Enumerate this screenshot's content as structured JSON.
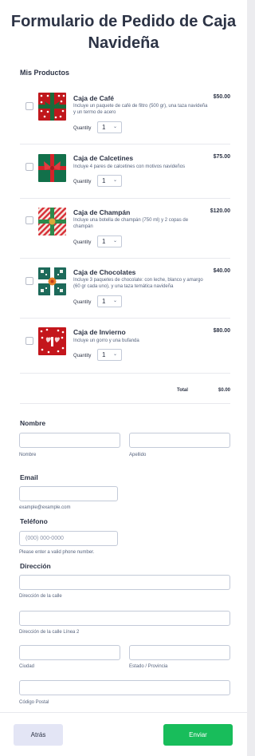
{
  "form": {
    "title_line1": "Formulario de Pedido de Caja",
    "title_line2": "Navideña",
    "products_label": "Mis Productos"
  },
  "products": [
    {
      "name": "Caja de Café",
      "price": "$50.00",
      "description": "Incluye un paquete de café de filtro (500 gr), una taza navideña y un termo de acero",
      "quantity_label": "Quantity",
      "quantity": "1",
      "image_icon": "gift-box-red-dots-icon",
      "image_color": "#c0171c"
    },
    {
      "name": "Caja de Calcetines",
      "price": "$75.00",
      "description": "Incluye 4 pares de calcetines con motivos navideños",
      "quantity_label": "Quantity",
      "quantity": "1",
      "image_icon": "gift-box-green-icon",
      "image_color": "#12704a"
    },
    {
      "name": "Caja de Champán",
      "price": "$120.00",
      "description": "Incluye una botella de champán (750 ml) y 2 copas de champán",
      "quantity_label": "Quantity",
      "quantity": "1",
      "image_icon": "gift-box-candy-stripe-icon",
      "image_color": "#d8333a"
    },
    {
      "name": "Caja de Chocolates",
      "price": "$40.00",
      "description": "Incluye 3 paquetes de chocolate: con leche, blanco y amargo (60 gr cada uno), y una taza temática navideña",
      "quantity_label": "Quantity",
      "quantity": "1",
      "image_icon": "gift-box-teal-pattern-icon",
      "image_color": "#1d6a5a"
    },
    {
      "name": "Caja de Invierno",
      "price": "$80.00",
      "description": "Incluye un gorro y una bufanda",
      "quantity_label": "Quantity",
      "quantity": "1",
      "image_icon": "gift-box-red-hearts-icon",
      "image_color": "#c4161c"
    }
  ],
  "total": {
    "label": "Total",
    "value": "$0.00"
  },
  "fields": {
    "name": {
      "label": "Nombre",
      "first_sub": "Nombre",
      "last_sub": "Apellido",
      "first_value": "",
      "last_value": ""
    },
    "email": {
      "label": "Email",
      "sub": "example@example.com",
      "value": ""
    },
    "phone": {
      "label": "Teléfono",
      "placeholder": "(000) 000-0000",
      "sub": "Please enter a valid phone number."
    },
    "address": {
      "label": "Dirección",
      "street_sub": "Dirección de la calle",
      "street2_sub": "Dirección de la calle Línea 2",
      "city_sub": "Ciudad",
      "state_sub": "Estado / Provincia",
      "zip_sub": "Código Postal"
    }
  },
  "buttons": {
    "back": "Atrás",
    "submit": "Enviar"
  },
  "colors": {
    "submit": "#18bd5b",
    "back": "#e3e5f5",
    "text": "#2c3345"
  }
}
